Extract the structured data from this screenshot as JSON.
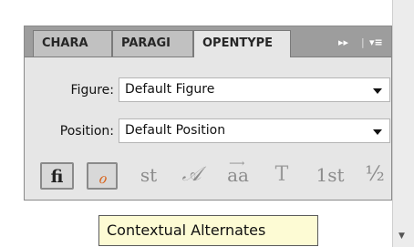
{
  "panel": {
    "tabs": [
      {
        "label": "CHARA",
        "active": false
      },
      {
        "label": "PARAGI",
        "active": false
      },
      {
        "label": "OPENTYPE",
        "active": true
      }
    ],
    "controls": {
      "collapse": "▸▸",
      "divider": "|",
      "menu": "▾≡"
    }
  },
  "figure": {
    "label": "Figure:",
    "value": "Default Figure"
  },
  "position": {
    "label": "Position:",
    "value": "Default Position"
  },
  "glyph_buttons": [
    {
      "name": "standard-ligatures",
      "glyph": "fi",
      "active": true
    },
    {
      "name": "contextual-alternates",
      "glyph": "ℴ",
      "active": true
    },
    {
      "name": "discretionary-ligatures",
      "glyph": "st",
      "active": false
    },
    {
      "name": "swash",
      "glyph": "𝒜",
      "active": false
    },
    {
      "name": "stylistic-alternates",
      "glyph": "aa",
      "active": false
    },
    {
      "name": "titling-alternates",
      "glyph": "T",
      "active": false
    },
    {
      "name": "ordinals",
      "glyph": "1st",
      "active": false
    },
    {
      "name": "fractions",
      "glyph": "½",
      "active": false
    }
  ],
  "tooltip": {
    "text": "Contextual Alternates"
  },
  "colors": {
    "accent_orange": "#d8651e",
    "tooltip_bg": "#fdfbd4",
    "tab_bar_bg": "#9d9d9d",
    "panel_bg": "#e6e6e6"
  }
}
